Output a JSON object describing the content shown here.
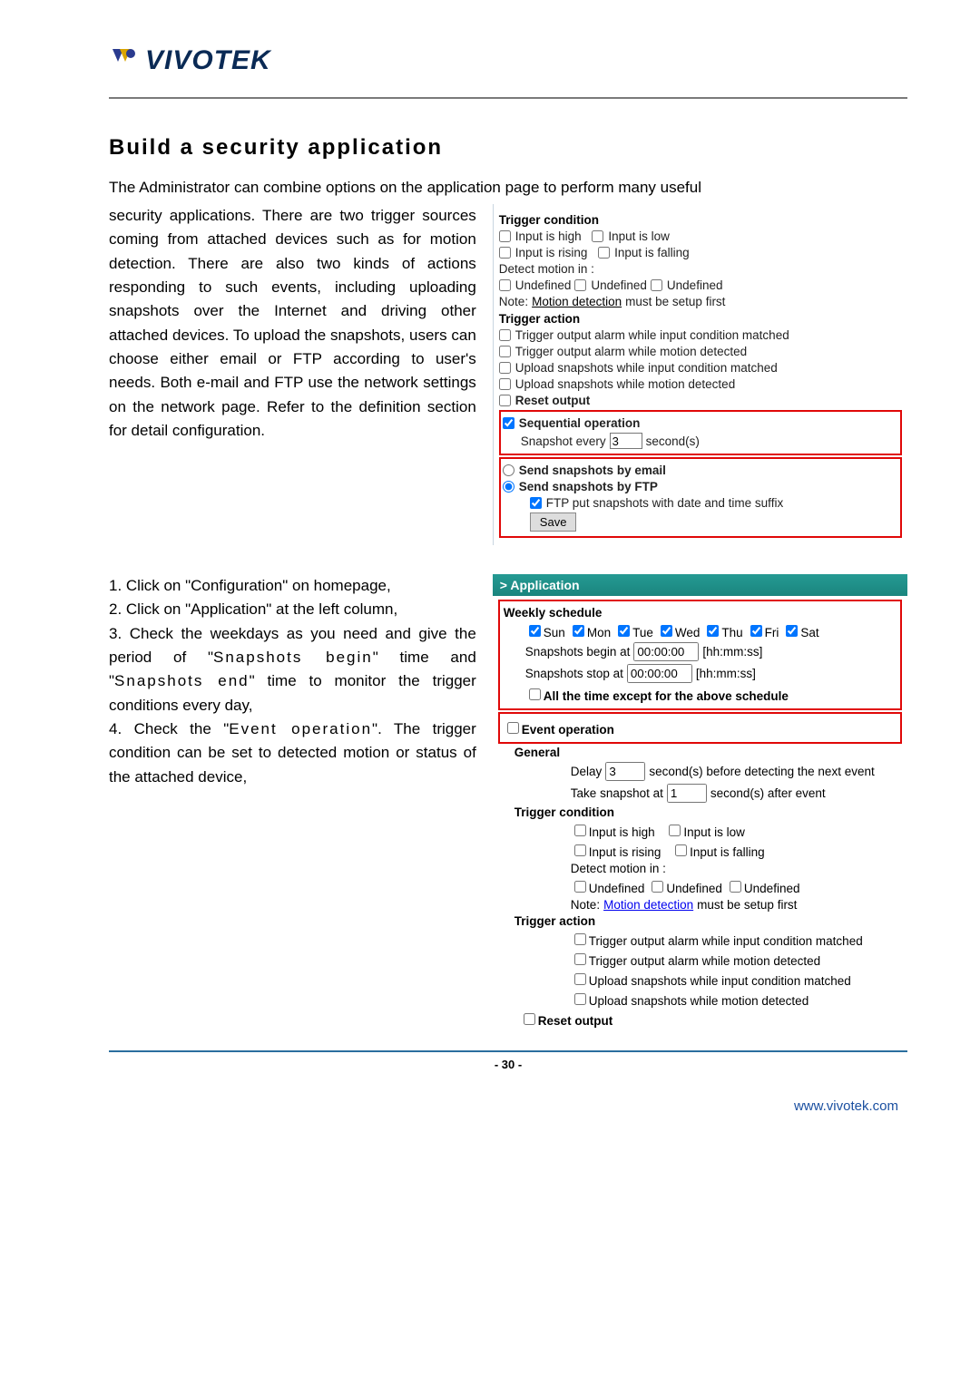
{
  "logo_text": "VIVOTEK",
  "section_heading": "Build a security application",
  "lead_sentence": "The Administrator can combine options on the application page to perform many useful",
  "para1": "security applications. There are two trigger sources coming from attached devices such as for motion detection. There are also two kinds of actions responding to such events, including uploading snapshots over the Internet and driving other attached devices. To upload the snapshots, users can choose either email or FTP according to user's needs. Both e-mail and FTP use the network settings on the network page. Refer to the definition section for detail configuration.",
  "steps": {
    "s1": "1. Click on \"Configuration\" on homepage,",
    "s2": "2. Click on \"Application\" at the left column,",
    "s3a": "3. Check the weekdays as you need and give the period of \"",
    "s3b": "Snapshots begin",
    "s3c": "\" time and \"",
    "s3d": "Snapshots end",
    "s3e": "\" time to monitor the trigger conditions every day,",
    "s4a": "4. Check the \"",
    "s4b": "Event operation",
    "s4c": "\". The trigger condition can be set to detected motion or status of the attached device,"
  },
  "panel1": {
    "trigger_condition": "Trigger condition",
    "input_high": "Input is high",
    "input_low": "Input is low",
    "input_rising": "Input is rising",
    "input_falling": "Input is falling",
    "detect_motion": "Detect motion in :",
    "undefined": "Undefined",
    "note_prefix": "Note: ",
    "note_link": "Motion detection",
    "note_suffix": " must be setup first",
    "trigger_action": "Trigger action",
    "ta1": "Trigger output alarm while input condition matched",
    "ta2": "Trigger output alarm while motion detected",
    "ta3": "Upload snapshots while input condition matched",
    "ta4": "Upload snapshots while motion detected",
    "reset_output": "Reset output",
    "seq_op": "Sequential operation",
    "snap_every_a": "Snapshot every",
    "snap_every_val": "3",
    "snap_every_b": "second(s)",
    "send_email": "Send snapshots by email",
    "send_ftp": "Send snapshots by FTP",
    "ftp_suffix": "FTP put snapshots with date and time suffix",
    "save": "Save"
  },
  "panel2": {
    "title": "> Application",
    "weekly_schedule": "Weekly schedule",
    "days": {
      "sun": "Sun",
      "mon": "Mon",
      "tue": "Tue",
      "wed": "Wed",
      "thu": "Thu",
      "fri": "Fri",
      "sat": "Sat"
    },
    "snap_begin_a": "Snapshots begin at",
    "snap_begin_val": "00:00:00",
    "hhmmss": "[hh:mm:ss]",
    "snap_stop_a": "Snapshots stop at",
    "snap_stop_val": "00:00:00",
    "all_time": "All the time except for the above schedule",
    "event_op": "Event operation",
    "general": "General",
    "delay_a": "Delay",
    "delay_val": "3",
    "delay_b": "second(s) before detecting the next event",
    "take_a": "Take snapshot at",
    "take_val": "1",
    "take_b": "second(s) after event",
    "trigger_condition": "Trigger condition",
    "input_high": "Input is high",
    "input_low": "Input is low",
    "input_rising": "Input is rising",
    "input_falling": "Input is falling",
    "detect_motion": "Detect motion in :",
    "undefined": "Undefined",
    "note_prefix": "Note: ",
    "note_link": "Motion detection",
    "note_suffix": " must be setup first",
    "trigger_action": "Trigger action",
    "ta1": "Trigger output alarm while input condition matched",
    "ta2": "Trigger output alarm while motion detected",
    "ta3": "Upload snapshots while input condition matched",
    "ta4": "Upload snapshots while motion detected",
    "reset_output": "Reset output"
  },
  "page_number": "- 30 -",
  "site_url": "www.vivotek.com"
}
